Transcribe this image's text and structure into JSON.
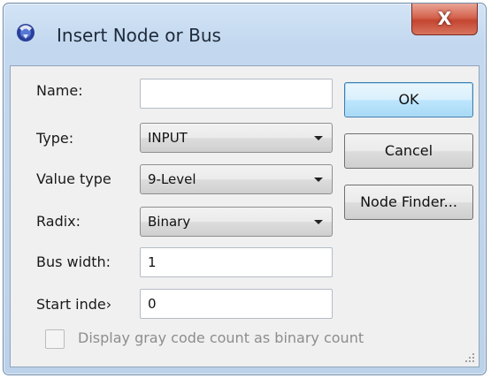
{
  "window": {
    "title": "Insert Node or Bus",
    "close_label": "X",
    "icon": "app-logo-icon"
  },
  "form": {
    "name_label": "Name:",
    "name_value": "",
    "type_label": "Type:",
    "type_value": "INPUT",
    "value_type_label": "Value type",
    "value_type_value": "9-Level",
    "radix_label": "Radix:",
    "radix_value": "Binary",
    "bus_width_label": "Bus width:",
    "bus_width_value": "1",
    "start_index_label": "Start inde›",
    "start_index_value": "0",
    "checkbox_label": "Display gray code count as binary count",
    "checkbox_checked": false,
    "checkbox_enabled": false
  },
  "buttons": {
    "ok": "OK",
    "cancel": "Cancel",
    "node_finder": "Node Finder..."
  },
  "colors": {
    "close_button": "#c34631",
    "default_button_border": "#3c7fb1",
    "dialog_frame": "#c3d8ef",
    "client_bg": "#f0f0f0"
  }
}
